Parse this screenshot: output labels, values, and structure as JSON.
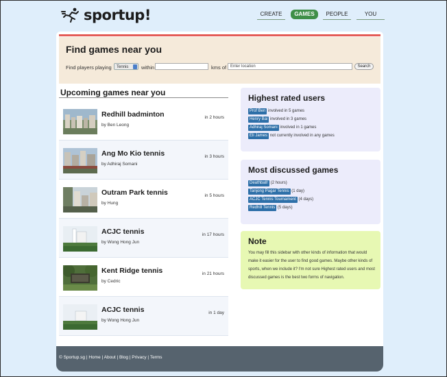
{
  "brand": {
    "name": "sportup!"
  },
  "nav": {
    "create": "CREATE",
    "games": "GAMES",
    "people": "PEOPLE",
    "you": "YOU",
    "active": "games"
  },
  "search": {
    "title": "Find games near you",
    "label_playing": "Find players playing",
    "sport_selected": "Tennis",
    "label_within": "within",
    "label_kms": "kms of",
    "location_placeholder": "Enter location",
    "button": "Search"
  },
  "upcoming": {
    "title": "Upcoming games near you",
    "games": [
      {
        "title": "Redhill badminton",
        "by": "by Ben Leong",
        "time": "in 2 hours"
      },
      {
        "title": "Ang Mo Kio tennis",
        "by": "by Adhiraj Somani",
        "time": "in 3 hours"
      },
      {
        "title": "Outram Park tennis",
        "by": "by Hung",
        "time": "in 5 hours"
      },
      {
        "title": "ACJC tennis",
        "by": "by Wong Hong Jun",
        "time": "in 17 hours"
      },
      {
        "title": "Kent Ridge tennis",
        "by": "by Cedric",
        "time": "in 21 hours"
      },
      {
        "title": "ACJC tennis",
        "by": "by Wong Hong Jun",
        "time": "in 1 day"
      }
    ]
  },
  "highest_rated": {
    "title": "Highest rated users",
    "users": [
      {
        "name": "Prof Ben",
        "detail": "involved in 5 games"
      },
      {
        "name": "Henry Bai",
        "detail": "involved in 3 games"
      },
      {
        "name": "Adhiraj Somani",
        "detail": "involved in 1 games"
      },
      {
        "name": "Eli James",
        "detail": "not currently involved in any games"
      }
    ]
  },
  "most_discussed": {
    "title": "Most discussed games",
    "games": [
      {
        "name": "Deathball!",
        "detail": "(2 hours)"
      },
      {
        "name": "Tanjong Pagar Tennis",
        "detail": "(1 day)"
      },
      {
        "name": "ACJC Tennis Tournament",
        "detail": "(4 days)"
      },
      {
        "name": "Redhill Tennis",
        "detail": "(5 days)"
      }
    ]
  },
  "note": {
    "title": "Note",
    "text": "You may fill this sidebar with other kinds of information that would make it easier for the user to find good games. Maybe other kinds of sports, when we include it? I'm not sure Highest rated users and most discussed games is the best two forms of navigation."
  },
  "footer": {
    "copyright": "© Sportup.sg",
    "links": [
      "Home",
      "About",
      "Blog",
      "Privacy",
      "Terms"
    ]
  },
  "colors": {
    "background": "#dfeefb",
    "accent_green": "#3f8f48",
    "accent_red": "#e35a55",
    "search_band": "#f5eada",
    "sidebar_box": "#ececfb",
    "note_box": "#e7f8b3",
    "tag_blue": "#2d6fa8",
    "footer": "#56636e"
  }
}
